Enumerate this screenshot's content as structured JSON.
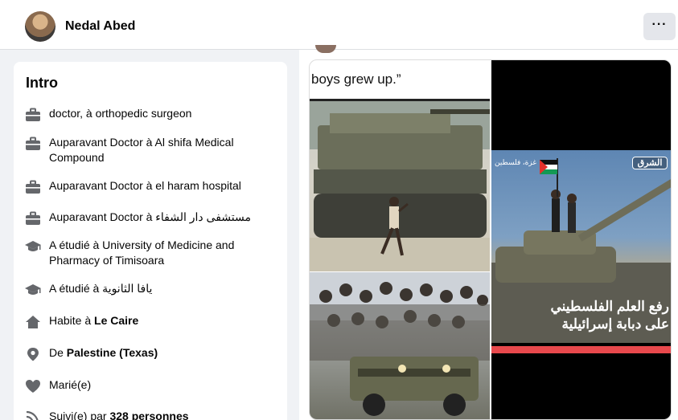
{
  "header": {
    "profile_name": "Nedal Abed",
    "more_label": "···"
  },
  "intro": {
    "title": "Intro",
    "items": [
      {
        "icon": "briefcase-icon",
        "text": "doctor, à orthopedic surgeon"
      },
      {
        "icon": "briefcase-icon",
        "text": "Auparavant Doctor à Al shifa Medical Compound"
      },
      {
        "icon": "briefcase-icon",
        "text": "Auparavant Doctor à el haram hospital"
      },
      {
        "icon": "briefcase-icon",
        "text": "Auparavant Doctor à مستشفى دار الشفاء"
      },
      {
        "icon": "graduation-cap-icon",
        "text": "A étudié à University of Medicine and Pharmacy of Timisoara"
      },
      {
        "icon": "graduation-cap-icon",
        "text": "A étudié à يافا الثانوية"
      },
      {
        "icon": "home-icon",
        "prefix": "Habite à ",
        "bold": "Le Caire"
      },
      {
        "icon": "location-pin-icon",
        "prefix": "De ",
        "bold": "Palestine (Texas)"
      },
      {
        "icon": "heart-icon",
        "text": "Marié(e)"
      },
      {
        "icon": "rss-icon",
        "prefix": "Suivi(e) par ",
        "bold": "328 personnes"
      }
    ]
  },
  "post": {
    "quote_text": "boys grew up.”",
    "media_right": {
      "brand": "الشرق",
      "location": "غزة، فلسطين",
      "headline_line1": "رفع العلم الفلسطيني",
      "headline_line2": "على دبابة إسرائيلية"
    }
  },
  "colors": {
    "page_bg": "#f0f2f5",
    "card_bg": "#ffffff",
    "icon_gray": "#65676b",
    "accent_red": "#e8494d"
  }
}
